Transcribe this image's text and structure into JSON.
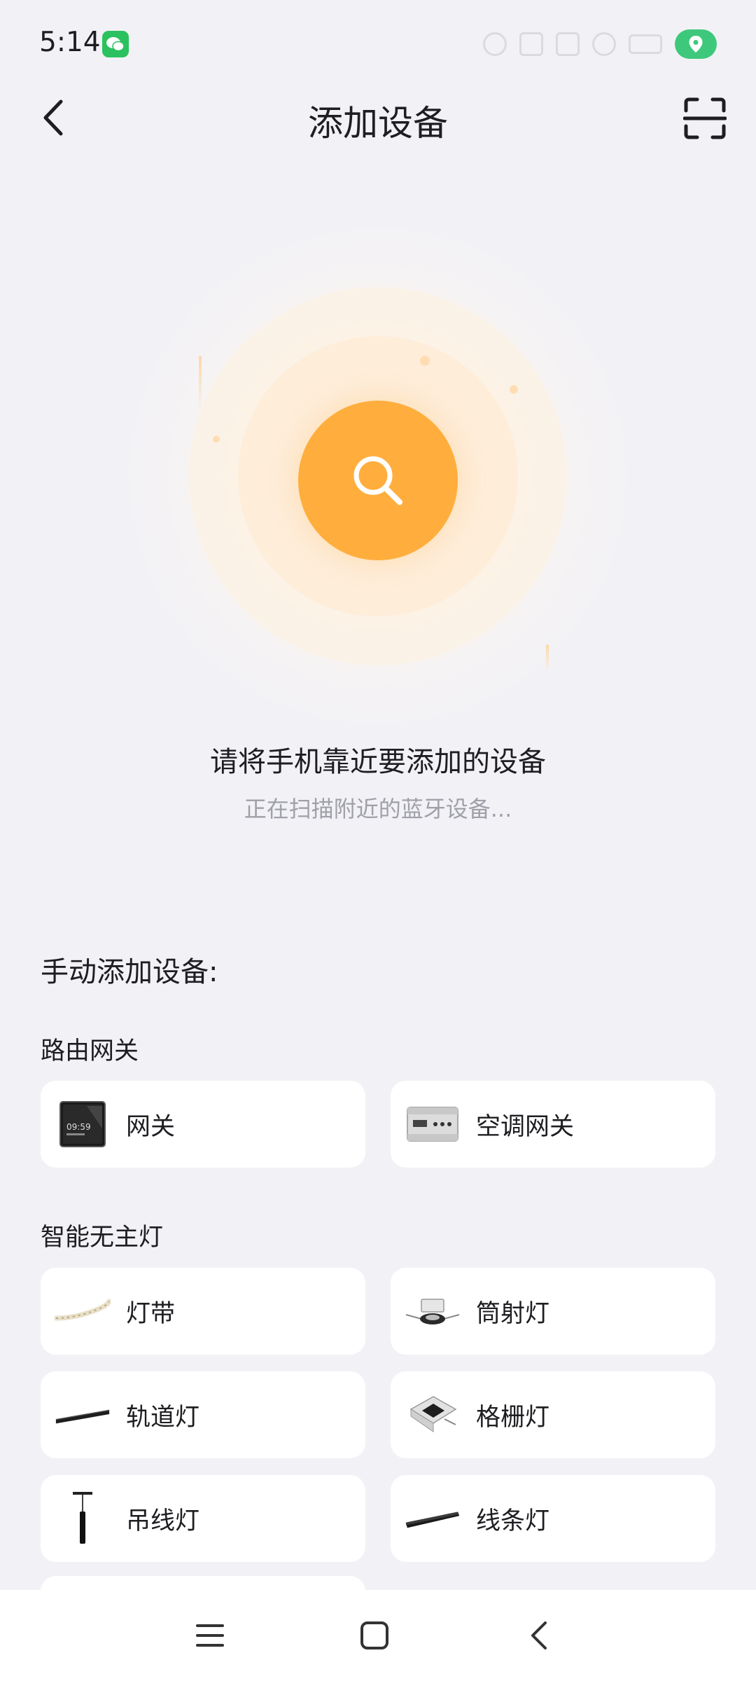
{
  "status_bar": {
    "time": "5:14",
    "app_icon": "wechat-icon",
    "location_color": "#35c675"
  },
  "header": {
    "title": "添加设备",
    "back_icon": "chevron-left-icon",
    "scan_icon": "scan-icon"
  },
  "scanner": {
    "icon": "search-icon",
    "accent": "#ffae3d",
    "instruction": "请将手机靠近要添加的设备",
    "status": "正在扫描附近的蓝牙设备..."
  },
  "manual": {
    "title": "手动添加设备:",
    "sections": [
      {
        "title": "路由网关",
        "items": [
          {
            "label": "网关",
            "icon": "gateway-panel-icon"
          },
          {
            "label": "空调网关",
            "icon": "ac-gateway-icon"
          }
        ]
      },
      {
        "title": "智能无主灯",
        "items": [
          {
            "label": "灯带",
            "icon": "light-strip-icon"
          },
          {
            "label": "筒射灯",
            "icon": "downlight-icon"
          },
          {
            "label": "轨道灯",
            "icon": "track-light-icon"
          },
          {
            "label": "格栅灯",
            "icon": "grille-light-icon"
          },
          {
            "label": "吊线灯",
            "icon": "pendant-light-icon"
          },
          {
            "label": "线条灯",
            "icon": "linear-light-icon"
          }
        ]
      }
    ]
  },
  "nav": {
    "menu_icon": "menu-icon",
    "home_icon": "home-icon",
    "back_icon": "back-icon"
  }
}
